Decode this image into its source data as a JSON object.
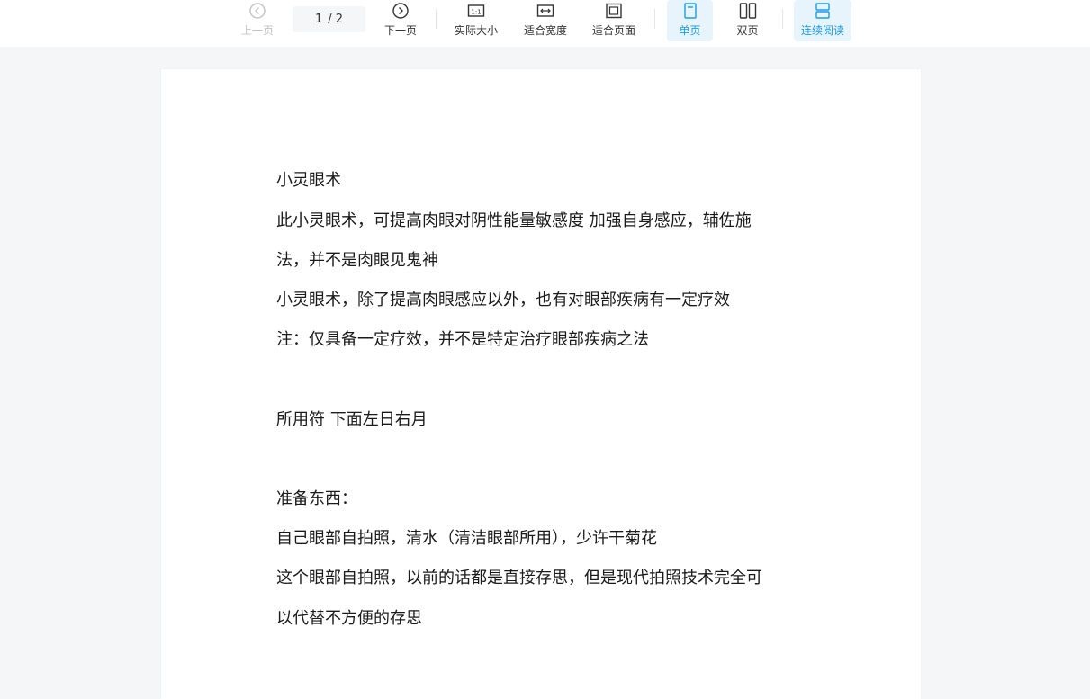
{
  "toolbar": {
    "prev_label": "上一页",
    "page_current": "1",
    "page_total": "/ 2",
    "next_label": "下一页",
    "actual_size_label": "实际大小",
    "fit_width_label": "适合宽度",
    "fit_page_label": "适合页面",
    "single_page_label": "单页",
    "double_page_label": "双页",
    "continuous_label": "连续阅读"
  },
  "colors": {
    "accent": "#1a9be6",
    "active_bg": "#e8f4fc",
    "disabled": "#c4c4c4",
    "viewer_bg": "#f4f6f8"
  },
  "icons": {
    "prev": "chevron-left-circle-icon",
    "next": "chevron-right-circle-icon",
    "actual_size": "one-to-one-icon",
    "fit_width": "fit-width-icon",
    "fit_page": "fit-page-icon",
    "single_page": "single-page-icon",
    "double_page": "double-page-icon",
    "continuous": "continuous-reading-icon"
  },
  "document": {
    "lines": [
      "小灵眼术",
      "此小灵眼术，可提高肉眼对阴性能量敏感度 加强自身感应，辅佐施",
      "法，并不是肉眼见鬼神",
      "小灵眼术，除了提高肉眼感应以外，也有对眼部疾病有一定疗效",
      "注：仅具备一定疗效，并不是特定治疗眼部疾病之法",
      "所用符 下面左日右月",
      "准备东西：",
      "自己眼部自拍照，清水（清洁眼部所用），少许干菊花",
      "这个眼部自拍照，以前的话都是直接存思，但是现代拍照技术完全可",
      "以代替不方便的存思"
    ]
  }
}
